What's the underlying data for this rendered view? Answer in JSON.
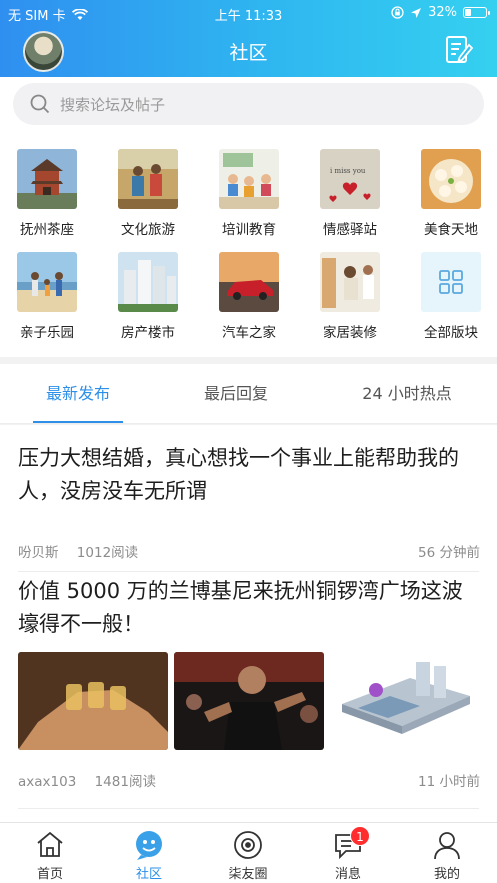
{
  "status_bar": {
    "carrier": "无 SIM 卡",
    "time": "上午 11:33",
    "battery": "32%",
    "battery_level": 0.32
  },
  "nav": {
    "title": "社区",
    "avatar_icon": "user-avatar",
    "compose_icon": "compose-icon"
  },
  "search": {
    "placeholder": "搜索论坛及帖子"
  },
  "boards": [
    {
      "label": "抚州茶座",
      "icon": "tower-photo"
    },
    {
      "label": "文化旅游",
      "icon": "hikers-photo"
    },
    {
      "label": "培训教育",
      "icon": "classroom-photo"
    },
    {
      "label": "情感驿站",
      "icon": "hearts-photo"
    },
    {
      "label": "美食天地",
      "icon": "dumplings-photo"
    },
    {
      "label": "亲子乐园",
      "icon": "family-beach-photo"
    },
    {
      "label": "房产楼市",
      "icon": "buildings-photo"
    },
    {
      "label": "汽车之家",
      "icon": "car-photo"
    },
    {
      "label": "家居装修",
      "icon": "painting-wall-photo"
    },
    {
      "label": "全部版块",
      "icon": "grid-icon"
    }
  ],
  "tabs": [
    {
      "label": "最新发布",
      "active": true
    },
    {
      "label": "最后回复",
      "active": false
    },
    {
      "label": "24 小时热点",
      "active": false
    }
  ],
  "posts": [
    {
      "title": "压力大想结婚，真心想找一个事业上能帮助我的人，没房没车无所谓",
      "author": "吩贝斯",
      "reads": "1012阅读",
      "time": "56 分钟前"
    },
    {
      "title": "价值 5000 万的兰博基尼来抚州铜锣湾广场这波壕得不一般！",
      "author": "axax103",
      "reads": "1481阅读",
      "time": "11 小时前",
      "images": [
        "toast-photo",
        "concert-photo",
        "plaza-render"
      ]
    }
  ],
  "tabbar": [
    {
      "label": "首页",
      "icon": "home-icon",
      "active": false
    },
    {
      "label": "社区",
      "icon": "community-icon",
      "active": true
    },
    {
      "label": "柒友圈",
      "icon": "camera-circle-icon",
      "active": false
    },
    {
      "label": "消息",
      "icon": "message-icon",
      "active": false,
      "badge": "1"
    },
    {
      "label": "我的",
      "icon": "profile-icon",
      "active": false
    }
  ],
  "colors": {
    "accent": "#2d8fe8",
    "header_start": "#2f8ff0",
    "header_end": "#35d0f0",
    "badge": "#ff2d2d"
  }
}
